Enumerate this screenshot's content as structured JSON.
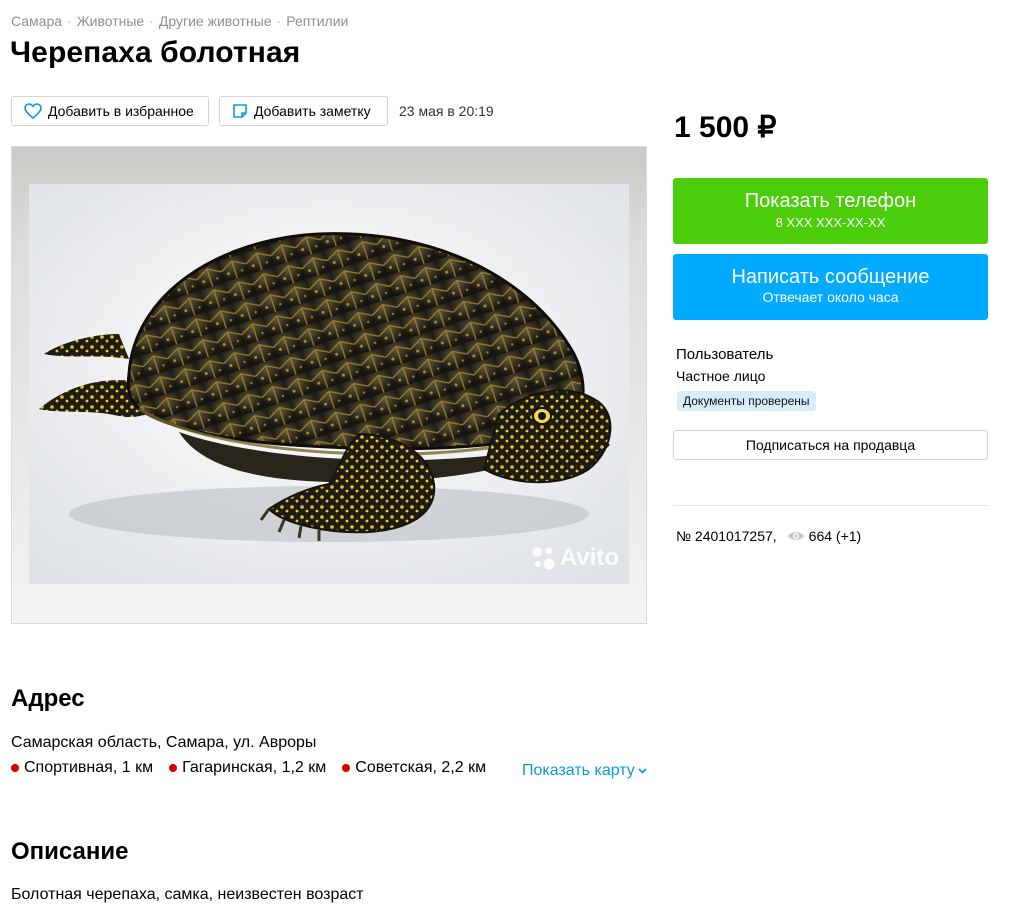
{
  "breadcrumbs": [
    "Самара",
    "Животные",
    "Другие животные",
    "Рептилии"
  ],
  "title": "Черепаха болотная",
  "actions": {
    "favorite_label": "Добавить в избранное",
    "note_label": "Добавить заметку",
    "date": "23 мая в 20:19"
  },
  "gallery": {
    "watermark": "Avito"
  },
  "sidebar": {
    "price": "1 500 ₽",
    "phone_button": {
      "label": "Показать телефон",
      "sub": "8 XXX XXX-XX-XX"
    },
    "message_button": {
      "label": "Написать сообщение",
      "sub": "Отвечает около часа"
    },
    "seller": {
      "name": "Пользователь",
      "type": "Частное лицо",
      "badge": "Документы проверены"
    },
    "subscribe_label": "Подписаться на продавца",
    "item_number": "№ 2401017257,",
    "views": "664 (+1)"
  },
  "address_section": {
    "heading": "Адрес",
    "address": "Самарская область, Самара, ул. Авроры",
    "metro": [
      {
        "name": "Спортивная, 1 км"
      },
      {
        "name": "Гагаринская, 1,2 км"
      },
      {
        "name": "Советская, 2,2 км"
      }
    ],
    "show_map_label": "Показать карту"
  },
  "description_section": {
    "heading": "Описание",
    "text": "Болотная черепаха, самка, неизвестен возраст"
  },
  "colors": {
    "green": "#4bcd0c",
    "blue": "#00aaff",
    "link": "#0a9bdd",
    "metro_dot": "#d50000",
    "badge_bg": "#d6eefc"
  }
}
